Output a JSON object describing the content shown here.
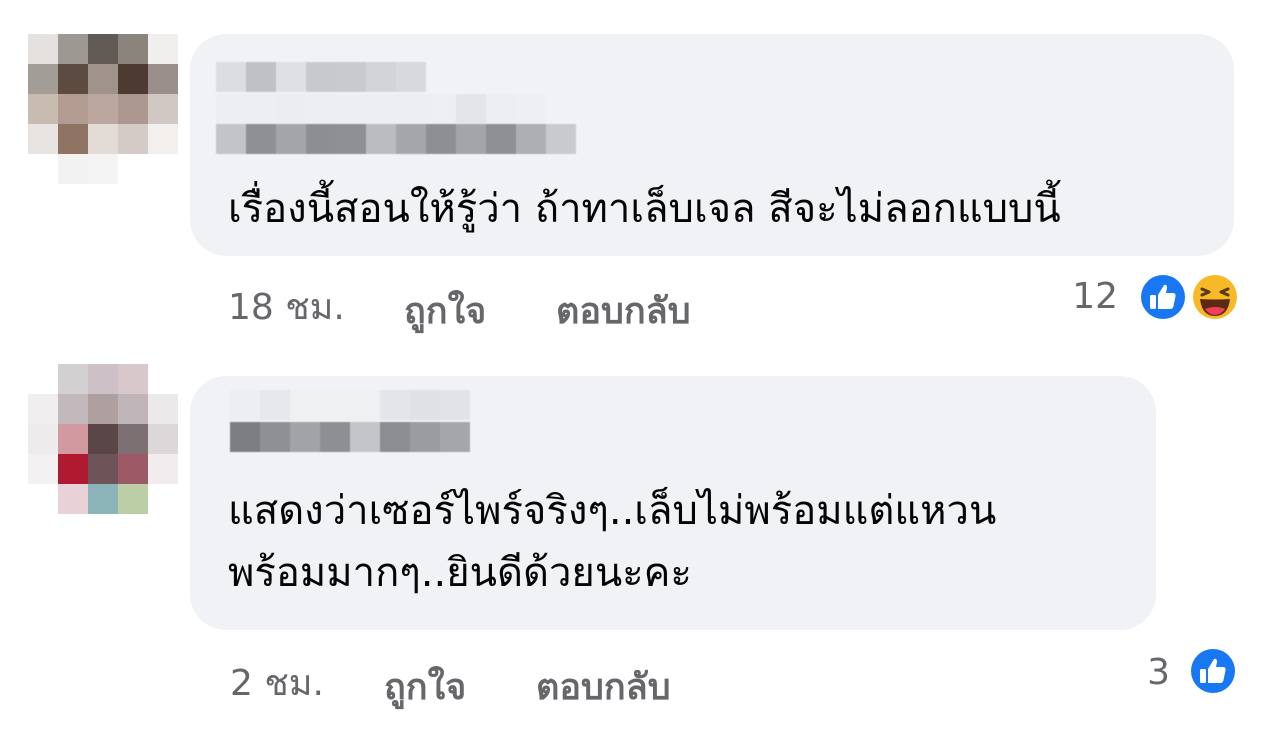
{
  "comments": [
    {
      "text_lines": [
        "เรื่องนี้สอนให้รู้ว่า ถ้าทาเล็บเจล สีจะไม่ลอกแบบนี้"
      ],
      "time": "18 ชม.",
      "like_label": "ถูกใจ",
      "reply_label": "ตอบกลับ",
      "reaction_count": "12",
      "reactions": [
        "like-icon",
        "haha-icon"
      ]
    },
    {
      "text_lines": [
        "แสดงว่าเซอร์ไพร์จริงๆ..เล็บไม่พร้อมแต่แหวน",
        "พร้อมมากๆ..ยินดีด้วยนะคะ"
      ],
      "time": "2 ชม.",
      "like_label": "ถูกใจ",
      "reply_label": "ตอบกลับ",
      "reaction_count": "3",
      "reactions": [
        "like-icon"
      ]
    }
  ],
  "colors": {
    "bubble": "#f0f2f5",
    "meta_text": "#65676b",
    "body_text": "#050505",
    "like_blue": "#1877f2",
    "haha_yellow": "#f7b928"
  }
}
